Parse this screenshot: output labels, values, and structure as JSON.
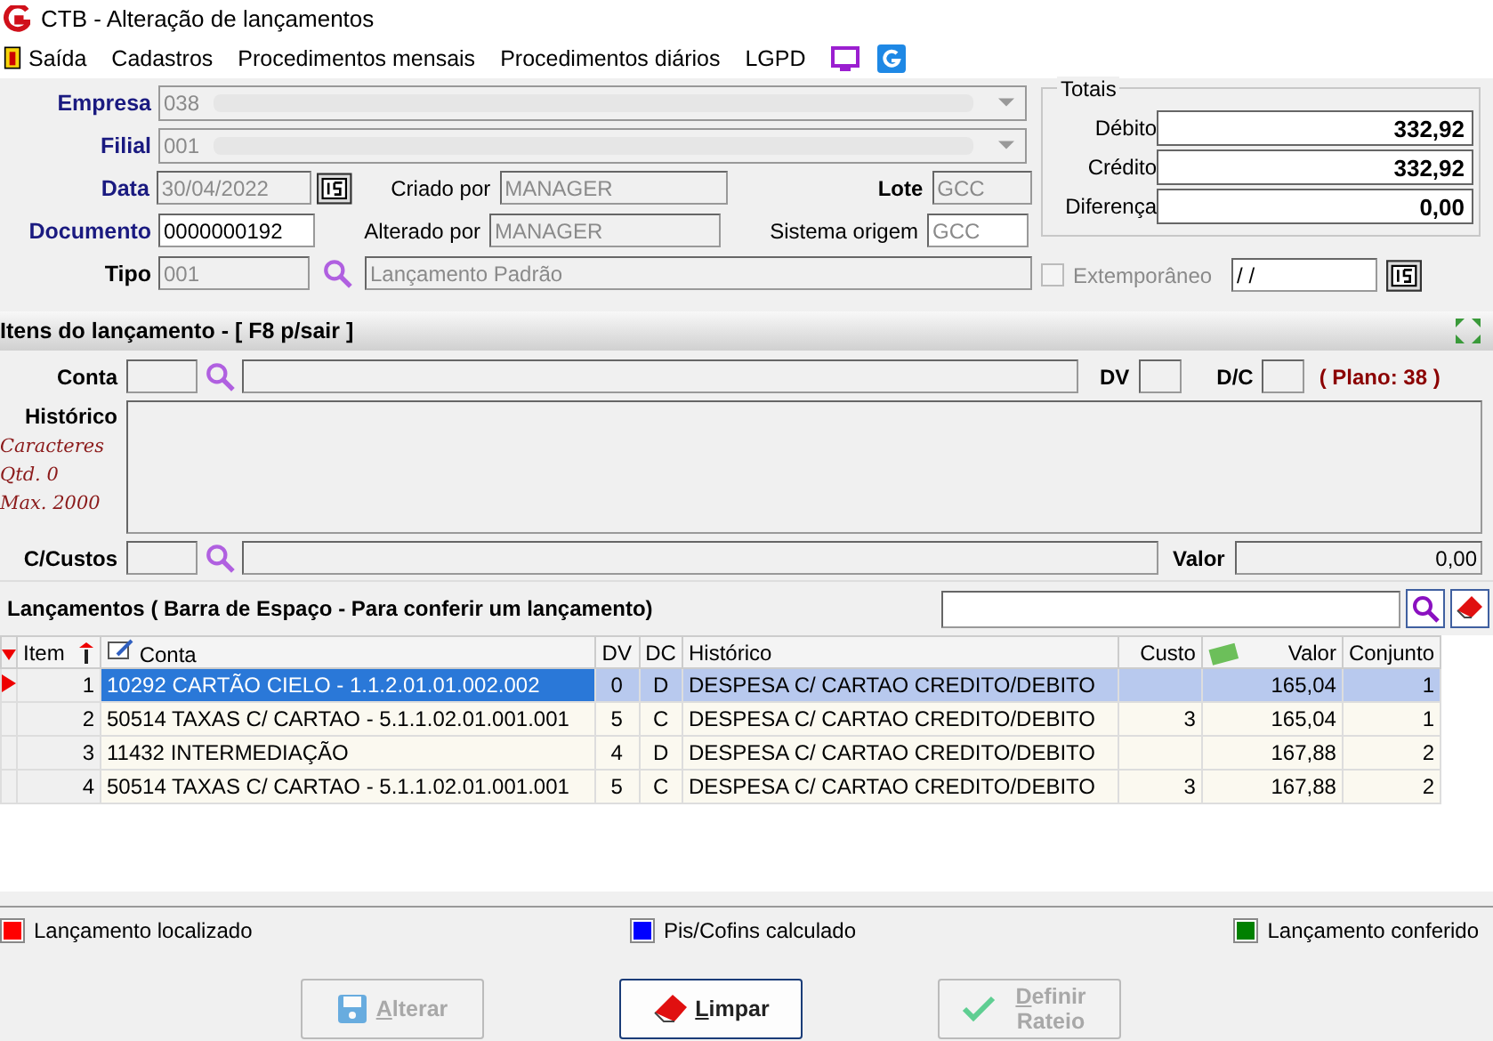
{
  "window": {
    "title": "CTB - Alteração de lançamentos"
  },
  "menu": [
    "Saída",
    "Cadastros",
    "Procedimentos mensais",
    "Procedimentos diários",
    "LGPD"
  ],
  "header": {
    "empresa": {
      "label": "Empresa",
      "value": "038"
    },
    "filial": {
      "label": "Filial",
      "value": "001"
    },
    "data": {
      "label": "Data",
      "value": "30/04/2022"
    },
    "documento": {
      "label": "Documento",
      "value": "0000000192"
    },
    "tipo": {
      "label": "Tipo",
      "code": "001",
      "description": "Lançamento Padrão"
    },
    "criado_por": {
      "label": "Criado por",
      "value": "MANAGER"
    },
    "alterado_por": {
      "label": "Alterado por",
      "value": "MANAGER"
    },
    "lote": {
      "label": "Lote",
      "value": "GCC"
    },
    "sistema_origem": {
      "label": "Sistema origem",
      "value": "GCC"
    }
  },
  "totais": {
    "title": "Totais",
    "rows": [
      {
        "label": "Débito",
        "value": "332,92"
      },
      {
        "label": "Crédito",
        "value": "332,92"
      },
      {
        "label": "Diferença",
        "value": "0,00"
      }
    ]
  },
  "extemporaneo": {
    "label": "Extemporâneo",
    "checked": false,
    "disabled": true,
    "date": "/ /"
  },
  "items_section": {
    "title": "Itens do lançamento - [ F8 p/sair ]",
    "conta_label": "Conta",
    "dv_label": "DV",
    "dc_label": "D/C",
    "plano": "( Plano: 38 )",
    "historico_label": "Histórico",
    "chars": [
      "Caracteres",
      "Qtd. 0",
      "Max. 2000"
    ],
    "ccustos_label": "C/Custos",
    "valor_label": "Valor",
    "valor": "0,00"
  },
  "lancamentos": {
    "title": "Lançamentos ( Barra de Espaço - Para conferir um lançamento)",
    "columns": [
      "Item",
      "Conta",
      "DV",
      "DC",
      "Histórico",
      "Custo",
      "Valor",
      "Conjunto"
    ],
    "rows": [
      {
        "item": "1",
        "conta": "10292 CARTÃO CIELO - 1.1.2.01.01.002.002",
        "dv": "0",
        "dc": "D",
        "historico": "DESPESA C/ CARTAO CREDITO/DEBITO",
        "custo": "",
        "valor": "165,04",
        "conjunto": "1",
        "selected": true
      },
      {
        "item": "2",
        "conta": "50514 TAXAS C/ CARTAO - 5.1.1.02.01.001.001",
        "dv": "5",
        "dc": "C",
        "historico": "DESPESA C/ CARTAO CREDITO/DEBITO",
        "custo": "3",
        "valor": "165,04",
        "conjunto": "1",
        "selected": false
      },
      {
        "item": "3",
        "conta": "11432 INTERMEDIAÇÃO",
        "dv": "4",
        "dc": "D",
        "historico": "DESPESA C/ CARTAO CREDITO/DEBITO",
        "custo": "",
        "valor": "167,88",
        "conjunto": "2",
        "selected": false
      },
      {
        "item": "4",
        "conta": "50514 TAXAS C/ CARTAO - 5.1.1.02.01.001.001",
        "dv": "5",
        "dc": "C",
        "historico": "DESPESA C/ CARTAO CREDITO/DEBITO",
        "custo": "3",
        "valor": "167,88",
        "conjunto": "2",
        "selected": false
      }
    ]
  },
  "legend": [
    {
      "label": "Lançamento localizado",
      "color": "#ff0000"
    },
    {
      "label": "Pis/Cofins calculado",
      "color": "#0000ff"
    },
    {
      "label": "Lançamento conferido",
      "color": "#008000"
    }
  ],
  "buttons": [
    {
      "label": "Alterar",
      "kind": "save",
      "disabled": true
    },
    {
      "label": "Limpar",
      "kind": "eraser",
      "disabled": false
    },
    {
      "label": "Definir Rateio",
      "kind": "check",
      "disabled": true
    }
  ]
}
